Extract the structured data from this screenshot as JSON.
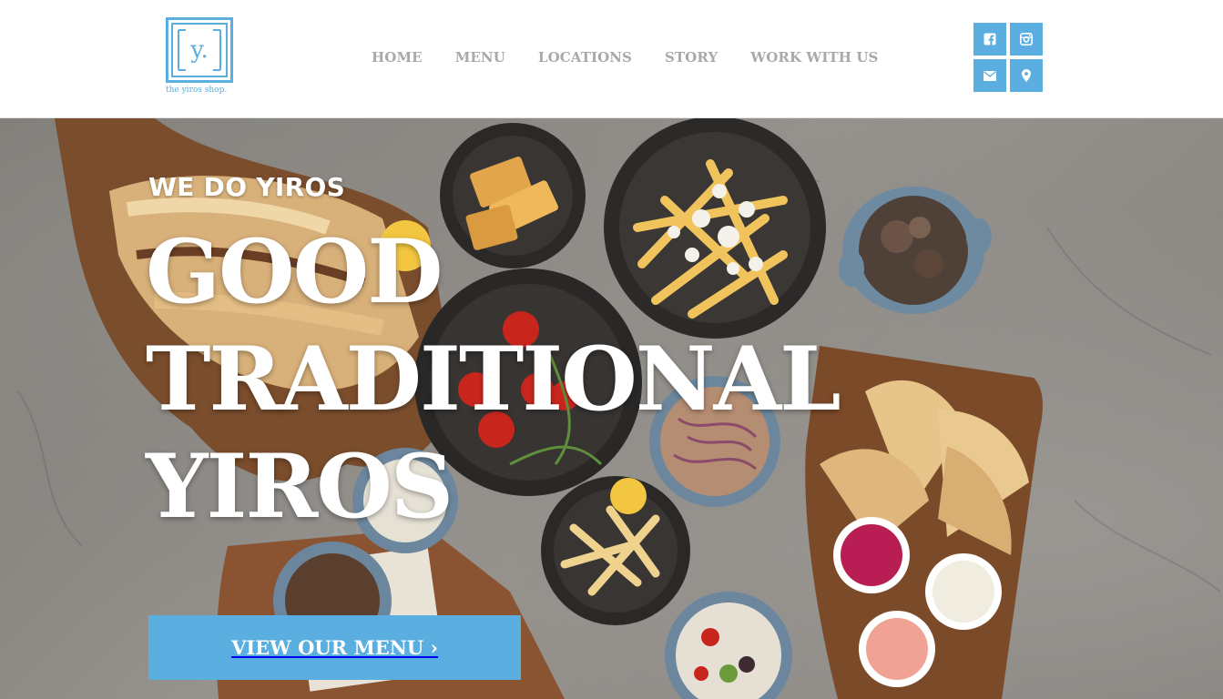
{
  "brand": {
    "logo_letter": "y.",
    "logo_text": "the yiros shop.",
    "accent_color": "#5aaee0"
  },
  "nav": {
    "items": [
      {
        "label": "HOME"
      },
      {
        "label": "MENU"
      },
      {
        "label": "LOCATIONS"
      },
      {
        "label": "STORY"
      },
      {
        "label": "WORK WITH US"
      }
    ]
  },
  "social": {
    "icons": [
      "facebook-icon",
      "instagram-icon",
      "email-icon",
      "map-pin-icon"
    ]
  },
  "hero": {
    "eyebrow": "WE DO YIROS",
    "headline": [
      "GOOD",
      "TRADITIONAL",
      "YIROS"
    ],
    "cta_label": "VIEW OUR MENU ›"
  }
}
